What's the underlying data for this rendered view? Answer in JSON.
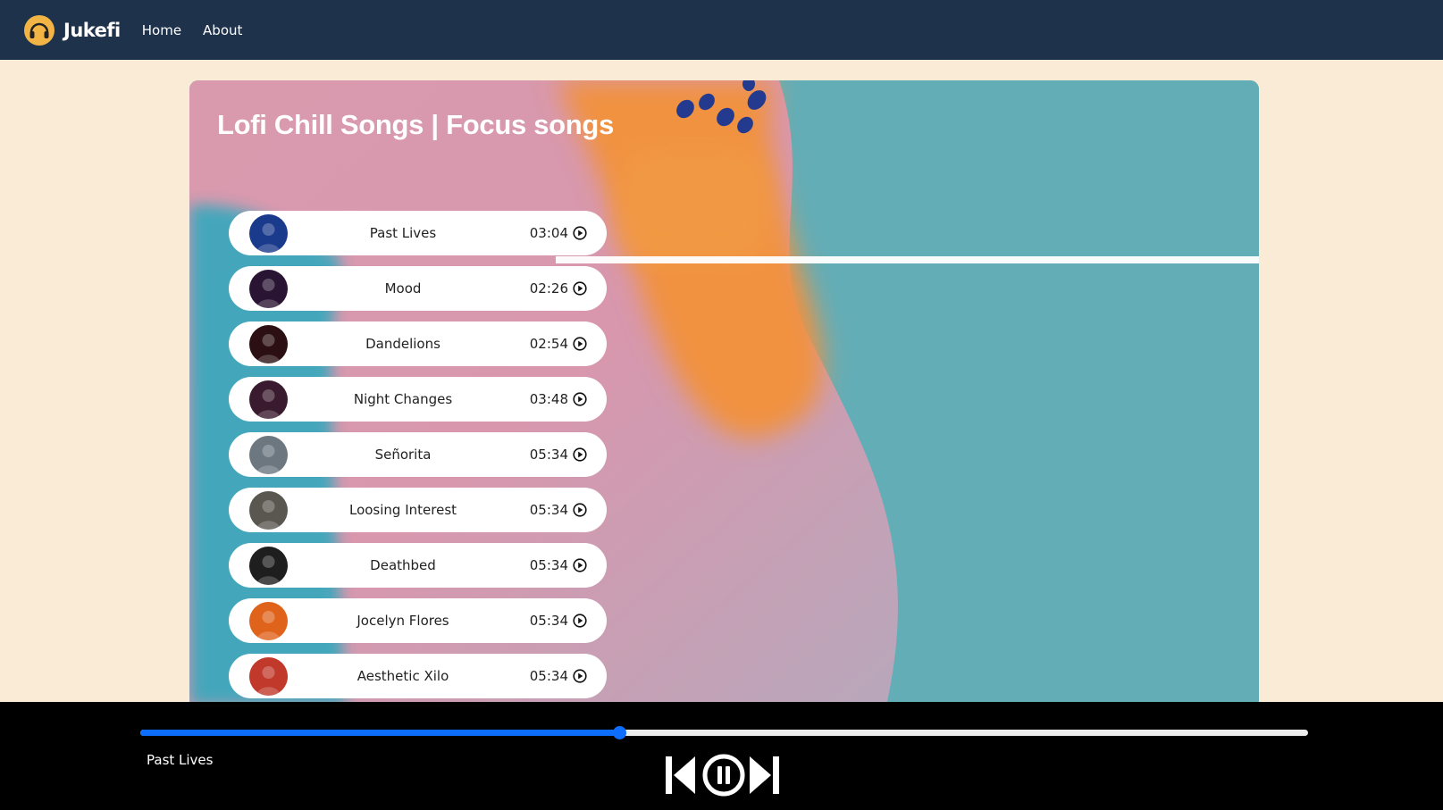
{
  "navbar": {
    "brand": "Jukefi",
    "links": [
      "Home",
      "About"
    ]
  },
  "playlist": {
    "title": "Lofi Chill Songs | Focus songs",
    "songs": [
      {
        "title": "Past Lives",
        "duration": "03:04",
        "thumb_color": "#1a3a8c"
      },
      {
        "title": "Mood",
        "duration": "02:26",
        "thumb_color": "#2a1433"
      },
      {
        "title": "Dandelions",
        "duration": "02:54",
        "thumb_color": "#2b0f12"
      },
      {
        "title": "Night Changes",
        "duration": "03:48",
        "thumb_color": "#3a1a2e"
      },
      {
        "title": "Señorita",
        "duration": "05:34",
        "thumb_color": "#6d7780"
      },
      {
        "title": "Loosing Interest",
        "duration": "05:34",
        "thumb_color": "#5a5650"
      },
      {
        "title": "Deathbed",
        "duration": "05:34",
        "thumb_color": "#1e1e1e"
      },
      {
        "title": "Jocelyn Flores",
        "duration": "05:34",
        "thumb_color": "#e0631c"
      },
      {
        "title": "Aesthetic Xilo",
        "duration": "05:34",
        "thumb_color": "#c0392b"
      }
    ]
  },
  "player": {
    "now_playing": "Past Lives",
    "progress_percent": 41,
    "accent": "#0d6efd"
  }
}
